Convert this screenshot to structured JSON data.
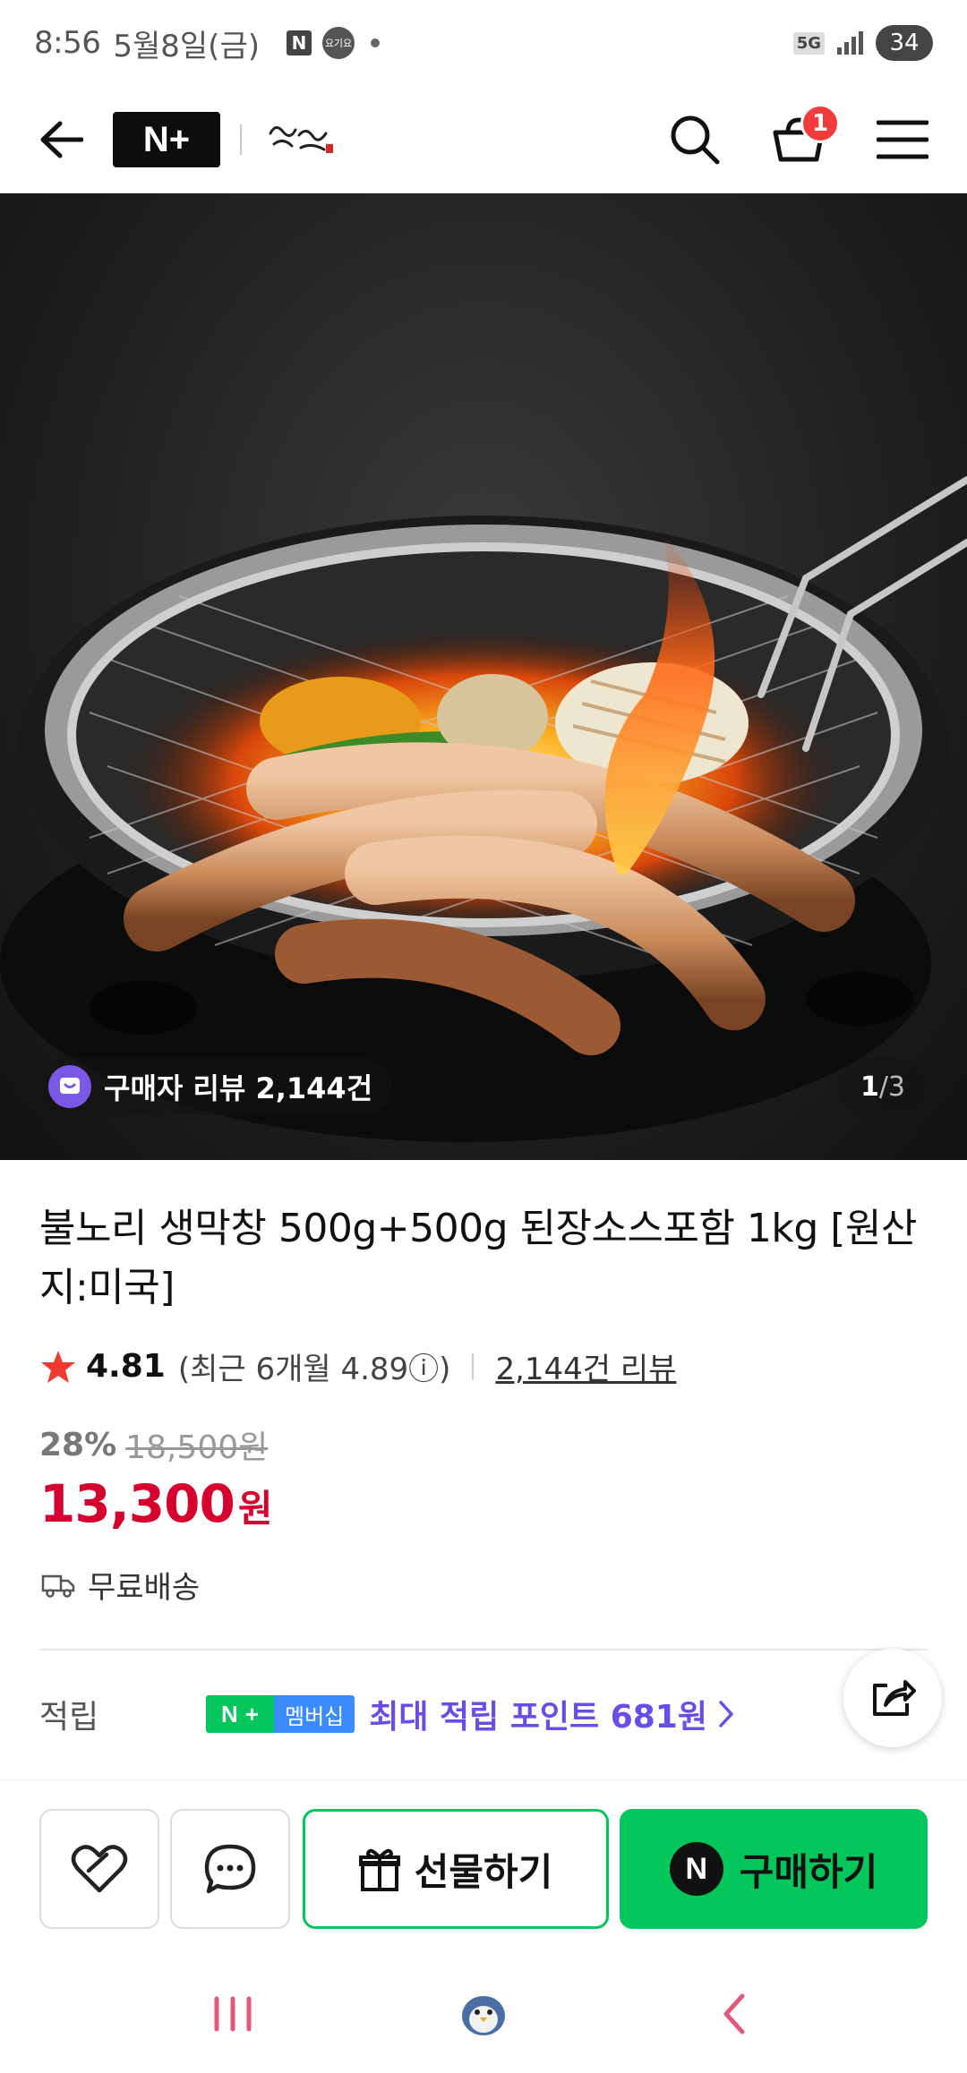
{
  "status_bar": {
    "time": "8:56",
    "date": "5월8일(금)",
    "notif_n": "N",
    "notif_app": "요기요",
    "network": "5G",
    "battery": "34"
  },
  "header": {
    "logo_text": "N+",
    "store_name": "불노리 생막창",
    "cart_count": "1"
  },
  "hero": {
    "review_badge": "구매자 리뷰 2,144건",
    "page_current": "1",
    "page_total": "/3"
  },
  "product": {
    "title": "불노리 생막창 500g+500g 된장소스포함 1kg [원산지:미국]",
    "rating": "4.81",
    "rating_recent": "(최근 6개월 4.89ⓘ)",
    "review_count": "2,144건 리뷰",
    "discount_rate": "28%",
    "original_price": "18,500원",
    "price": "13,300",
    "price_unit": "원",
    "shipping": "무료배송"
  },
  "points": {
    "label": "적립",
    "membership_label": "멤버십",
    "text": "최대 적립 포인트 681원"
  },
  "actions": {
    "gift_label": "선물하기",
    "buy_label": "구매하기",
    "buy_icon_letter": "N"
  },
  "colors": {
    "naver_green": "#03c75a",
    "price_red": "#d6002f",
    "points_purple": "#6a4ce6",
    "badge_red": "#f23c3c"
  }
}
